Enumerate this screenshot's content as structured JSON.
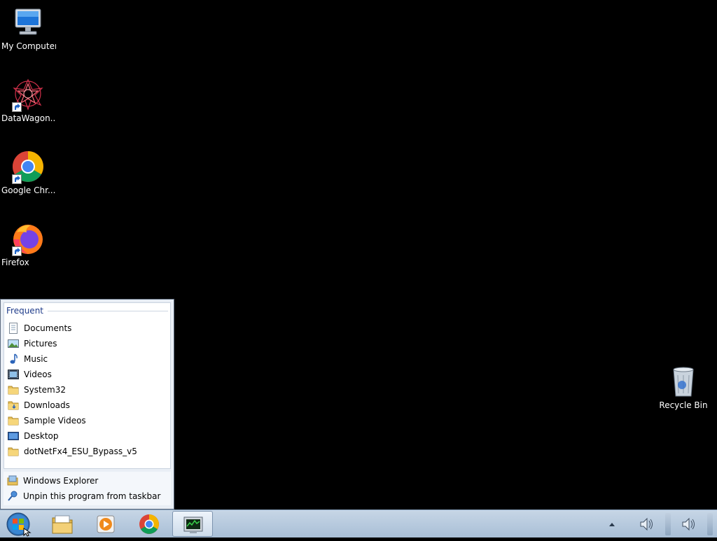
{
  "desktop": {
    "icons": [
      {
        "label": "My Computer",
        "icon": "computer-icon"
      },
      {
        "label": "DataWagon....",
        "icon": "datawagon-icon"
      },
      {
        "label": "Google Chr...",
        "icon": "chrome-icon"
      },
      {
        "label": "Firefox",
        "icon": "firefox-icon"
      },
      {
        "label": "Recycle Bin",
        "icon": "recycle-bin-icon"
      }
    ]
  },
  "jumplist": {
    "section_title": "Frequent",
    "items": [
      {
        "label": "Documents",
        "icon": "documents-icon"
      },
      {
        "label": "Pictures",
        "icon": "pictures-icon"
      },
      {
        "label": "Music",
        "icon": "music-icon"
      },
      {
        "label": "Videos",
        "icon": "videos-icon"
      },
      {
        "label": "System32",
        "icon": "folder-icon"
      },
      {
        "label": "Downloads",
        "icon": "downloads-folder-icon"
      },
      {
        "label": "Sample Videos",
        "icon": "folder-icon"
      },
      {
        "label": "Desktop",
        "icon": "desktop-icon"
      },
      {
        "label": "dotNetFx4_ESU_Bypass_v5",
        "icon": "folder-icon"
      }
    ],
    "tasks": [
      {
        "label": "Windows Explorer",
        "icon": "windows-explorer-icon"
      },
      {
        "label": "Unpin this program from taskbar",
        "icon": "unpin-icon"
      }
    ]
  },
  "taskbar": {
    "pinned": [
      {
        "name": "windows-explorer",
        "icon": "folder-icon"
      },
      {
        "name": "media-player",
        "icon": "media-player-icon"
      },
      {
        "name": "chrome",
        "icon": "chrome-icon"
      },
      {
        "name": "task-manager",
        "icon": "task-manager-icon"
      }
    ],
    "tray": [
      {
        "name": "show-hidden-icons",
        "icon": "triangle-up-icon"
      },
      {
        "name": "volume",
        "icon": "speaker-icon"
      },
      {
        "name": "volume-2",
        "icon": "speaker-icon"
      }
    ]
  },
  "colors": {
    "desktop_bg": "#000000",
    "taskbar": "#b3c7db",
    "jumplist_section": "#1e3b8a"
  }
}
